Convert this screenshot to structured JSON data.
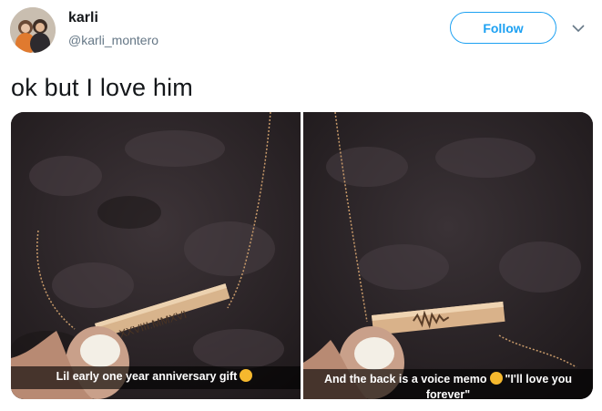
{
  "header": {
    "display_name": "karli",
    "handle": "@karli_montero",
    "follow_label": "Follow"
  },
  "tweet": {
    "text": "ok but I love him"
  },
  "media": {
    "left_caption": "Lil early one year anniversary gift",
    "left_engraving": "VIII.XXVIII.MMXVI",
    "right_caption_line1": "And the back is a voice memo",
    "right_caption_quote": "\"I'll love you",
    "right_caption_line2": "forever\""
  },
  "icons": [
    "avatar-photo",
    "chevron-down-icon",
    "heart-eyes-emoji",
    "crying-emoji"
  ]
}
